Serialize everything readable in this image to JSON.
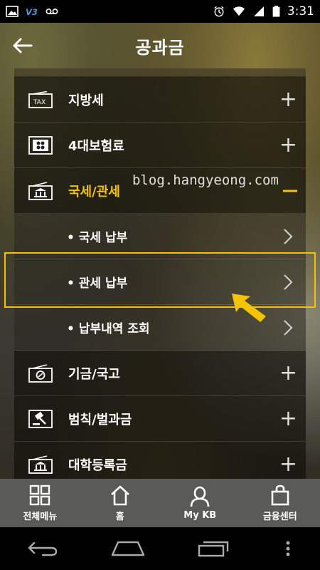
{
  "status_bar": {
    "time": "3:31",
    "left_icons": [
      "image-icon",
      "v3-icon",
      "voicemail-icon"
    ],
    "right_icons": [
      "alarm-icon",
      "wifi-icon",
      "signal-icon",
      "battery-icon"
    ]
  },
  "header": {
    "title": "공과금",
    "back_icon": "arrow-left-icon"
  },
  "menu": {
    "items": [
      {
        "label": "지방세",
        "icon": "tax-icon",
        "state": "collapsed"
      },
      {
        "label": "4대보험료",
        "icon": "insurance-icon",
        "state": "collapsed"
      },
      {
        "label": "국세/관세",
        "icon": "government-icon",
        "state": "expanded"
      },
      {
        "label": "기금/국고",
        "icon": "fund-icon",
        "state": "collapsed"
      },
      {
        "label": "범칙/벌과금",
        "icon": "gavel-icon",
        "state": "collapsed"
      },
      {
        "label": "대학등록금",
        "icon": "university-icon",
        "state": "collapsed"
      }
    ],
    "subitems": [
      {
        "label": "• 국세 납부"
      },
      {
        "label": "• 관세 납부"
      },
      {
        "label": "• 납부내역 조회"
      }
    ],
    "accent_color": "#f4c400"
  },
  "watermark": "blog.hangyeong.com",
  "bottom_nav": {
    "items": [
      {
        "label": "전체메뉴",
        "icon": "grid-menu-icon"
      },
      {
        "label": "홈",
        "icon": "home-icon"
      },
      {
        "label": "My KB",
        "icon": "person-icon"
      },
      {
        "label": "금융센터",
        "icon": "shopping-bag-icon"
      }
    ]
  },
  "system_nav": [
    "back-icon",
    "home-icon",
    "recents-icon",
    "more-icon"
  ]
}
